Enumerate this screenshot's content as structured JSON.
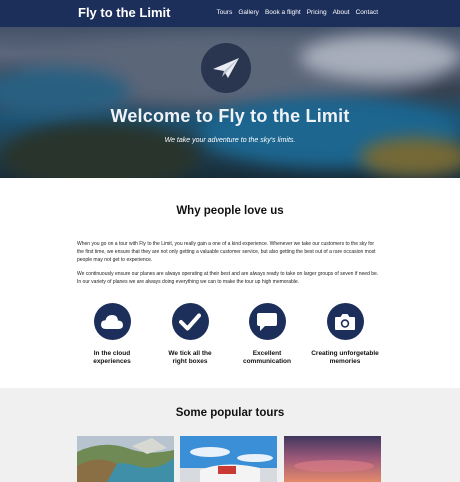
{
  "navbar": {
    "brand": "Fly to the Limit",
    "links": [
      "Tours",
      "Gallery",
      "Book a flight",
      "Pricing",
      "About",
      "Contact"
    ]
  },
  "hero": {
    "title": "Welcome to Fly to the Limit",
    "subtitle": "We take your adventure to the sky's limits.",
    "logo_icon": "paper-plane-icon"
  },
  "why": {
    "title": "Why people love us",
    "paragraph1": "When you go on a tour with Fly to the Limit, you really gain a one of a kind experience. Whenever we take our customers to the sky for the first time, we ensure that they are not only getting a valuable customer service, but also getting the best out of a rare occasion most people may not get to experience.",
    "paragraph2": "We continuously ensure our planes are always operating at their best and are always ready to take on larger groups of seven if need be. In our variety of planes we are always doing everything we can to make the tour up high memorable.",
    "features": [
      {
        "icon": "cloud-icon",
        "line1": "In the cloud",
        "line2": "experiences"
      },
      {
        "icon": "checkmark-icon",
        "line1": "We tick all the",
        "line2": "right boxes"
      },
      {
        "icon": "chat-icon",
        "line1": "Excellent",
        "line2": "communication"
      },
      {
        "icon": "camera-icon",
        "line1": "Creating unforgetable",
        "line2": "memories"
      }
    ]
  },
  "tours": {
    "title": "Some popular tours"
  },
  "colors": {
    "navy": "#1c2e5a",
    "light_section": "#f0f0f0"
  }
}
